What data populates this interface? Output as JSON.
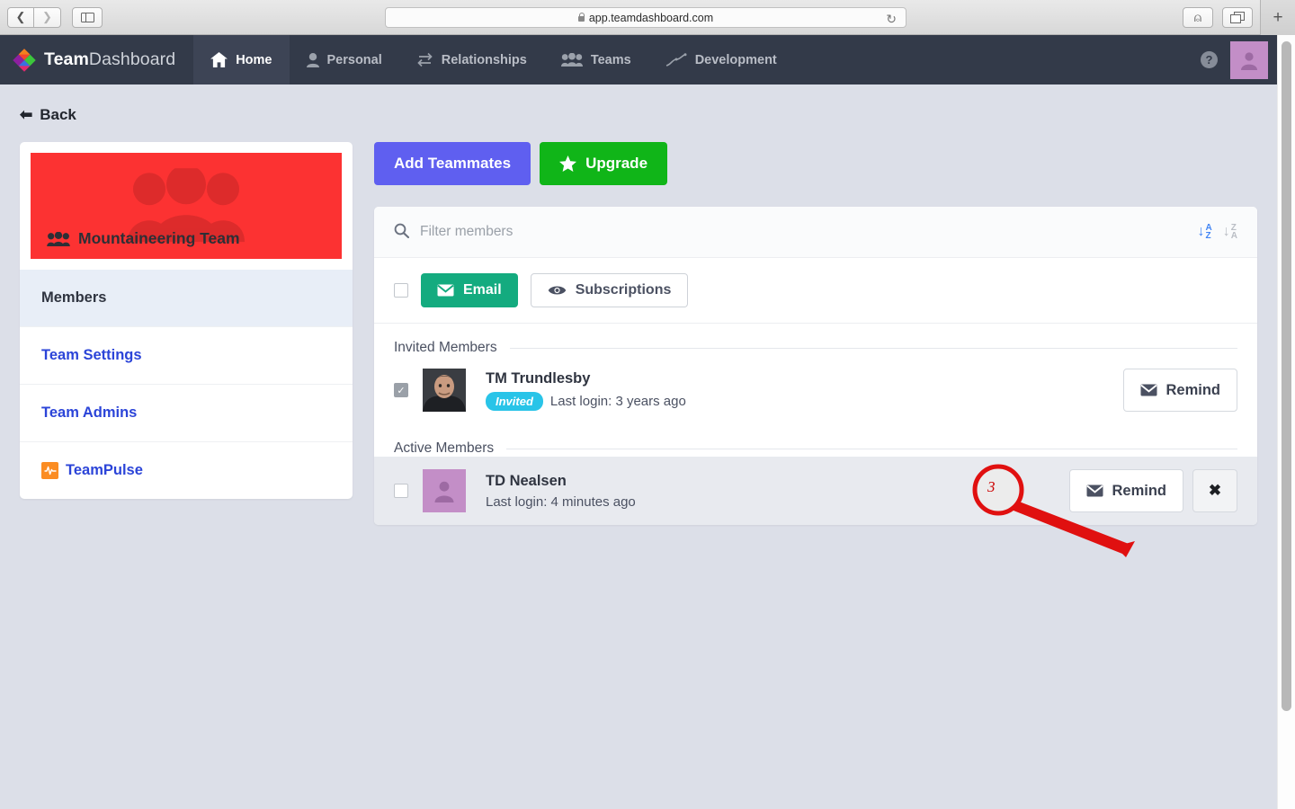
{
  "browser": {
    "url": "app.teamdashboard.com",
    "back_icon": "back-chevron-icon",
    "forward_icon": "forward-chevron-icon",
    "sidebar_icon": "sidebar-toggle-icon",
    "lock_icon": "lock-icon",
    "reload_icon": "reload-icon",
    "share_icon": "share-icon",
    "tabs_icon": "show-tabs-icon",
    "new_tab_label": "+"
  },
  "appnav": {
    "brand_bold": "Team",
    "brand_light": "Dashboard",
    "logo_icon": "diamond-logo-icon",
    "items": [
      {
        "label": "Home",
        "icon": "home-icon",
        "active": true
      },
      {
        "label": "Personal",
        "icon": "person-icon",
        "active": false
      },
      {
        "label": "Relationships",
        "icon": "exchange-arrows-icon",
        "active": false
      },
      {
        "label": "Teams",
        "icon": "group-icon",
        "active": false
      },
      {
        "label": "Development",
        "icon": "trending-line-icon",
        "active": false
      }
    ],
    "help_label": "?",
    "avatar_icon": "user-avatar-icon"
  },
  "page": {
    "back_label": "Back",
    "back_icon": "arrow-left-icon"
  },
  "sidebar": {
    "team_name": "Mountaineering Team",
    "team_icon": "group-icon",
    "banner_color": "#fc3232",
    "items": [
      {
        "label": "Members",
        "current": true,
        "icon": null
      },
      {
        "label": "Team Settings",
        "current": false,
        "icon": null
      },
      {
        "label": "Team Admins",
        "current": false,
        "icon": null
      },
      {
        "label": "TeamPulse",
        "current": false,
        "icon": "pulse-icon"
      }
    ]
  },
  "actions": {
    "add_teammates_label": "Add Teammates",
    "upgrade_label": "Upgrade",
    "upgrade_icon": "star-icon",
    "add_color": "#5f5ff0",
    "upgrade_color": "#10b518"
  },
  "filter": {
    "placeholder": "Filter members",
    "value": "",
    "search_icon": "search-icon",
    "sort_az_icon": "sort-alpha-asc-icon",
    "sort_az_top": "A",
    "sort_az_bottom": "Z",
    "sort_za_icon": "sort-alpha-desc-icon",
    "sort_za_top": "Z",
    "sort_za_bottom": "A",
    "sort_active_color": "#4285f4"
  },
  "toolbar": {
    "select_all_checked": false,
    "email_label": "Email",
    "email_icon": "envelope-icon",
    "email_color": "#14ab7f",
    "subscriptions_label": "Subscriptions",
    "subscriptions_icon": "eye-icon"
  },
  "sections": [
    {
      "title": "Invited Members",
      "members": [
        {
          "name": "TM Trundlesby",
          "checked": true,
          "avatar_type": "photo",
          "badge": "Invited",
          "badge_color": "#29c4e8",
          "last_login": "Last login: 3 years ago",
          "remind_label": "Remind",
          "remind_icon": "envelope-icon",
          "has_remove": false,
          "hovered": false
        }
      ]
    },
    {
      "title": "Active Members",
      "members": [
        {
          "name": "TD Nealsen",
          "checked": false,
          "avatar_type": "placeholder",
          "badge": null,
          "badge_color": null,
          "last_login": "Last login: 4 minutes ago",
          "remind_label": "Remind",
          "remind_icon": "envelope-icon",
          "has_remove": true,
          "remove_label": "✖",
          "hovered": true
        }
      ]
    }
  ],
  "annotation": {
    "number": "3",
    "color": "#e01010",
    "target": "remove-member-button"
  }
}
